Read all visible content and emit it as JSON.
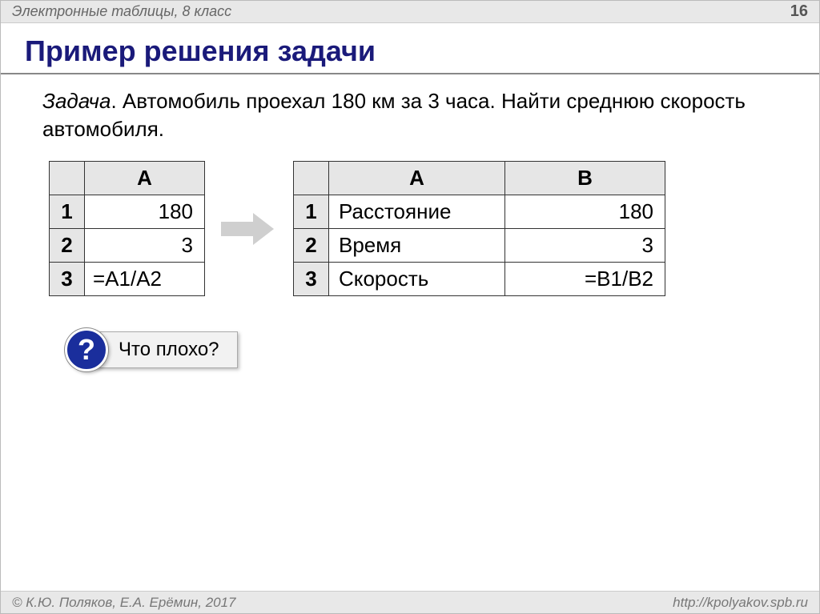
{
  "header": {
    "subject": "Электронные таблицы, 8 класс",
    "page": "16"
  },
  "title": "Пример решения задачи",
  "task": {
    "label": "Задача",
    "text": ". Автомобиль проехал 180 км за 3 часа. Найти среднюю скорость автомобиля."
  },
  "table1": {
    "colA": "A",
    "rows": [
      {
        "n": "1",
        "val": "180",
        "align": "val"
      },
      {
        "n": "2",
        "val": "3",
        "align": "val"
      },
      {
        "n": "3",
        "val": "=A1/A2",
        "align": "formula"
      }
    ]
  },
  "table2": {
    "colA": "A",
    "colB": "B",
    "rows": [
      {
        "n": "1",
        "label": "Расстояние",
        "val": "180"
      },
      {
        "n": "2",
        "label": "Время",
        "val": "3"
      },
      {
        "n": "3",
        "label": "Скорость",
        "val": "=B1/B2"
      }
    ]
  },
  "callout": {
    "icon": "?",
    "text": "Что плохо?"
  },
  "footer": {
    "copyright": "© К.Ю. Поляков, Е.А. Ерёмин, 2017",
    "url": "http://kpolyakov.spb.ru"
  }
}
